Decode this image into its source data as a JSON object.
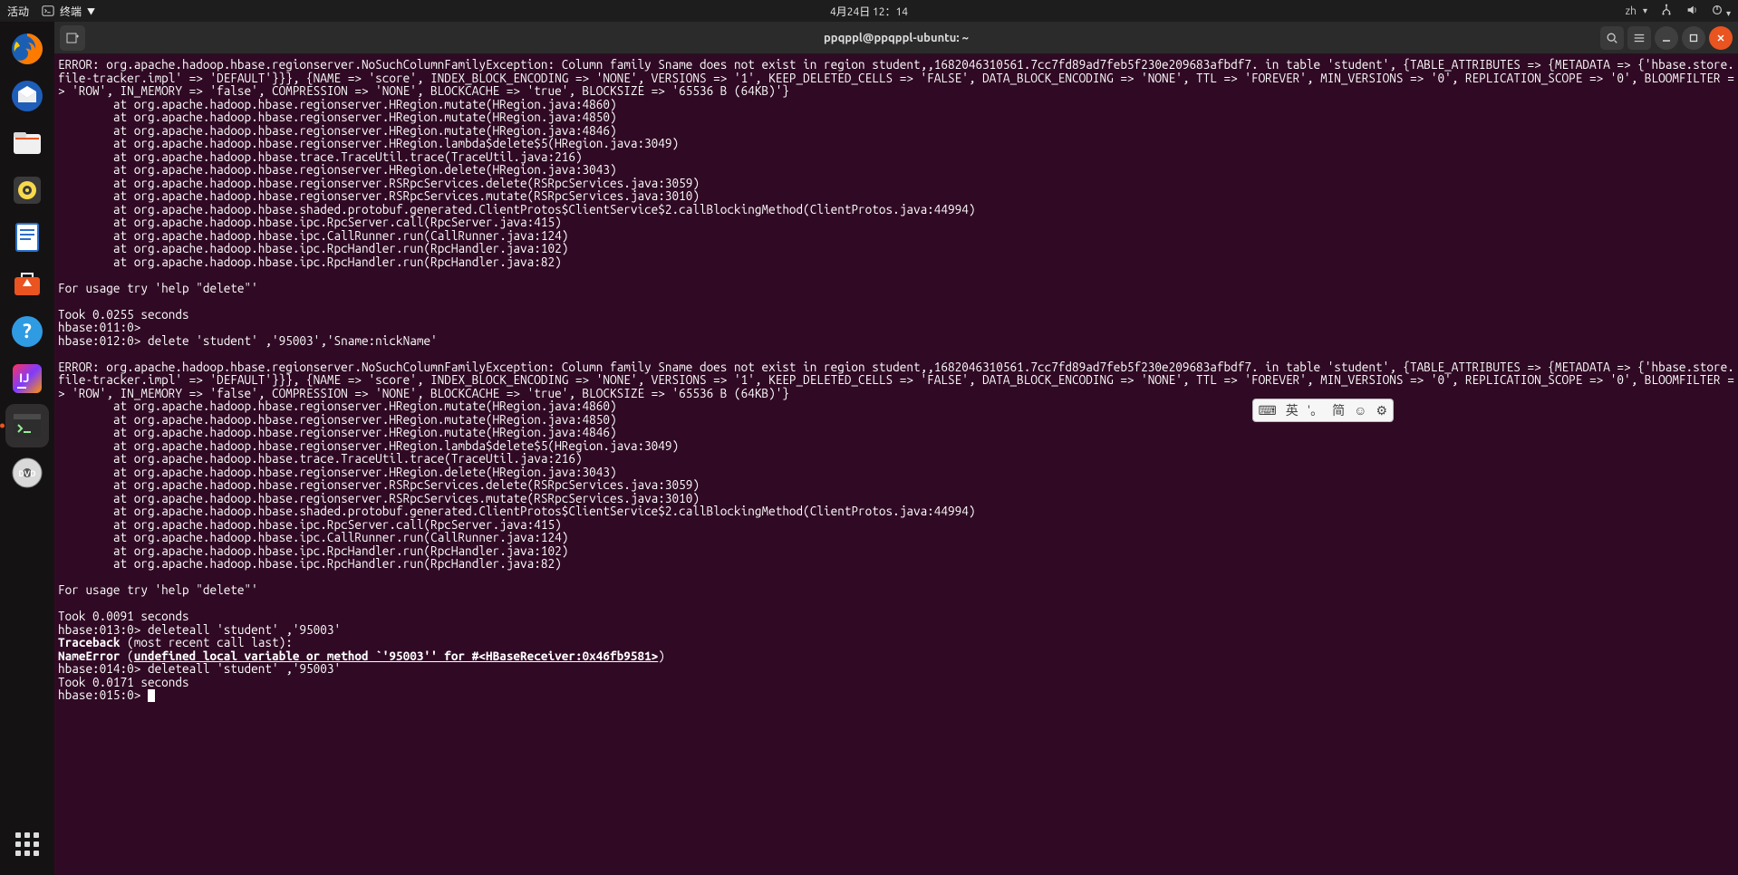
{
  "topbar": {
    "activities": "活动",
    "app_label": "终端",
    "datetime": "4月24日 12：14",
    "lang": "zh"
  },
  "window": {
    "title": "ppqppl@ppqppl-ubuntu: ~"
  },
  "ime": {
    "lang1": "英",
    "punct": "'。",
    "lang2": "简"
  },
  "terminal": {
    "lines": [
      "ERROR: org.apache.hadoop.hbase.regionserver.NoSuchColumnFamilyException: Column family Sname does not exist in region student,,1682046310561.7cc7fd89ad7feb5f230e209683afbdf7. in table 'student', {TABLE_ATTRIBUTES => {METADATA => {'hbase.store.file-tracker.impl' => 'DEFAULT'}}}, {NAME => 'score', INDEX_BLOCK_ENCODING => 'NONE', VERSIONS => '1', KEEP_DELETED_CELLS => 'FALSE', DATA_BLOCK_ENCODING => 'NONE', TTL => 'FOREVER', MIN_VERSIONS => '0', REPLICATION_SCOPE => '0', BLOOMFILTER => 'ROW', IN_MEMORY => 'false', COMPRESSION => 'NONE', BLOCKCACHE => 'true', BLOCKSIZE => '65536 B (64KB)'}",
      "        at org.apache.hadoop.hbase.regionserver.HRegion.mutate(HRegion.java:4860)",
      "        at org.apache.hadoop.hbase.regionserver.HRegion.mutate(HRegion.java:4850)",
      "        at org.apache.hadoop.hbase.regionserver.HRegion.mutate(HRegion.java:4846)",
      "        at org.apache.hadoop.hbase.regionserver.HRegion.lambda$delete$5(HRegion.java:3049)",
      "        at org.apache.hadoop.hbase.trace.TraceUtil.trace(TraceUtil.java:216)",
      "        at org.apache.hadoop.hbase.regionserver.HRegion.delete(HRegion.java:3043)",
      "        at org.apache.hadoop.hbase.regionserver.RSRpcServices.delete(RSRpcServices.java:3059)",
      "        at org.apache.hadoop.hbase.regionserver.RSRpcServices.mutate(RSRpcServices.java:3010)",
      "        at org.apache.hadoop.hbase.shaded.protobuf.generated.ClientProtos$ClientService$2.callBlockingMethod(ClientProtos.java:44994)",
      "        at org.apache.hadoop.hbase.ipc.RpcServer.call(RpcServer.java:415)",
      "        at org.apache.hadoop.hbase.ipc.CallRunner.run(CallRunner.java:124)",
      "        at org.apache.hadoop.hbase.ipc.RpcHandler.run(RpcHandler.java:102)",
      "        at org.apache.hadoop.hbase.ipc.RpcHandler.run(RpcHandler.java:82)",
      "",
      "For usage try 'help \"delete\"'",
      "",
      "Took 0.0255 seconds",
      "hbase:011:0>",
      "hbase:012:0> delete 'student' ,'95003','Sname:nickName'",
      "",
      "ERROR: org.apache.hadoop.hbase.regionserver.NoSuchColumnFamilyException: Column family Sname does not exist in region student,,1682046310561.7cc7fd89ad7feb5f230e209683afbdf7. in table 'student', {TABLE_ATTRIBUTES => {METADATA => {'hbase.store.file-tracker.impl' => 'DEFAULT'}}}, {NAME => 'score', INDEX_BLOCK_ENCODING => 'NONE', VERSIONS => '1', KEEP_DELETED_CELLS => 'FALSE', DATA_BLOCK_ENCODING => 'NONE', TTL => 'FOREVER', MIN_VERSIONS => '0', REPLICATION_SCOPE => '0', BLOOMFILTER => 'ROW', IN_MEMORY => 'false', COMPRESSION => 'NONE', BLOCKCACHE => 'true', BLOCKSIZE => '65536 B (64KB)'}",
      "        at org.apache.hadoop.hbase.regionserver.HRegion.mutate(HRegion.java:4860)",
      "        at org.apache.hadoop.hbase.regionserver.HRegion.mutate(HRegion.java:4850)",
      "        at org.apache.hadoop.hbase.regionserver.HRegion.mutate(HRegion.java:4846)",
      "        at org.apache.hadoop.hbase.regionserver.HRegion.lambda$delete$5(HRegion.java:3049)",
      "        at org.apache.hadoop.hbase.trace.TraceUtil.trace(TraceUtil.java:216)",
      "        at org.apache.hadoop.hbase.regionserver.HRegion.delete(HRegion.java:3043)",
      "        at org.apache.hadoop.hbase.regionserver.RSRpcServices.delete(RSRpcServices.java:3059)",
      "        at org.apache.hadoop.hbase.regionserver.RSRpcServices.mutate(RSRpcServices.java:3010)",
      "        at org.apache.hadoop.hbase.shaded.protobuf.generated.ClientProtos$ClientService$2.callBlockingMethod(ClientProtos.java:44994)",
      "        at org.apache.hadoop.hbase.ipc.RpcServer.call(RpcServer.java:415)",
      "        at org.apache.hadoop.hbase.ipc.CallRunner.run(CallRunner.java:124)",
      "        at org.apache.hadoop.hbase.ipc.RpcHandler.run(RpcHandler.java:102)",
      "        at org.apache.hadoop.hbase.ipc.RpcHandler.run(RpcHandler.java:82)",
      "",
      "For usage try 'help \"delete\"'",
      "",
      "Took 0.0091 seconds",
      "hbase:013:0> deleteall 'student' ,'95003'"
    ],
    "traceback_bold": "Traceback",
    "traceback_rest": " (most recent call last):",
    "nameerror_bold": "NameError",
    "nameerror_open": " (",
    "nameerror_underline": "undefined local variable or method `'95003'' for #<HBaseReceiver:0x46fb9581>",
    "nameerror_close": ")",
    "after_lines": [
      "hbase:014:0> deleteall 'student' ,'95003'",
      "Took 0.0171 seconds",
      "hbase:015:0> "
    ]
  }
}
